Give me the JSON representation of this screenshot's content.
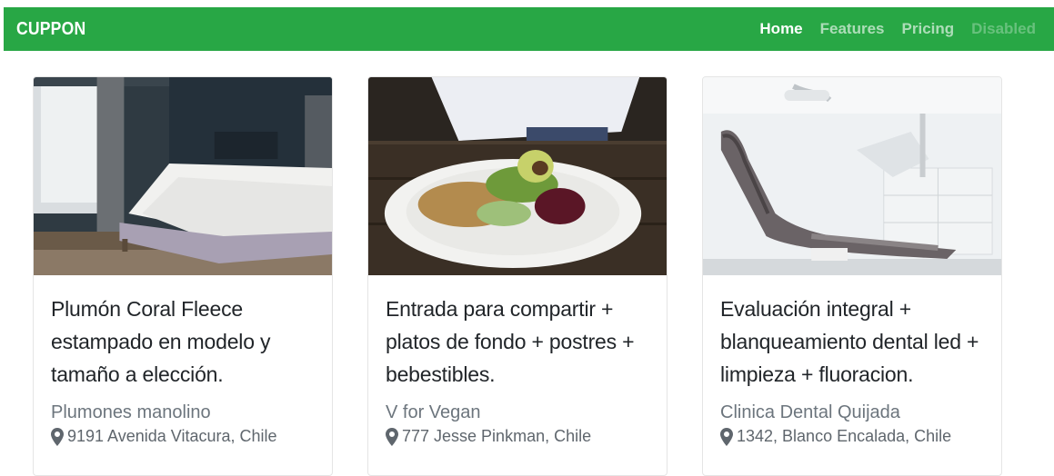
{
  "brand": "CUPPON",
  "nav": {
    "items": [
      {
        "label": "Home",
        "state": "active"
      },
      {
        "label": "Features",
        "state": "normal"
      },
      {
        "label": "Pricing",
        "state": "normal"
      },
      {
        "label": "Disabled",
        "state": "disabled"
      }
    ]
  },
  "colors": {
    "navbar": "#28a745",
    "title": "#212529",
    "muted": "#6c757d"
  },
  "cards": [
    {
      "image": "bedroom-photo",
      "title": "Plumón Coral Fleece estampado en modelo y tamaño a elección.",
      "merchant": "Plumones manolino",
      "location": "9191 Avenida Vitacura, Chile",
      "location_icon": "map-marker-icon"
    },
    {
      "image": "vegan-salad-photo",
      "title": "Entrada para compartir + platos de fondo + postres + bebestibles.",
      "merchant": "V for Vegan",
      "location": "777 Jesse Pinkman, Chile",
      "location_icon": "map-marker-icon"
    },
    {
      "image": "dental-chair-photo",
      "title": "Evaluación integral + blanqueamiento dental led + limpieza + fluoracion.",
      "merchant": "Clinica Dental Quijada",
      "location": "1342, Blanco Encalada, Chile",
      "location_icon": "map-marker-icon"
    }
  ]
}
